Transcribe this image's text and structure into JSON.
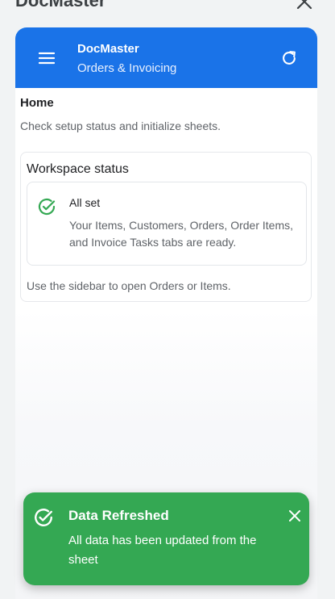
{
  "window": {
    "title": "DocMaster",
    "close_icon": "close-icon"
  },
  "header": {
    "title": "DocMaster",
    "subtitle": "Orders & Invoicing",
    "menu_icon": "menu-icon",
    "refresh_icon": "refresh-icon",
    "color": "#1a73e8"
  },
  "page": {
    "title": "Home",
    "description": "Check setup status and initialize sheets."
  },
  "workspace_card": {
    "title": "Workspace status",
    "status_title": "All set",
    "status_text": "Your Items, Customers, Orders, Order Items, and Invoice Tasks tabs are ready.",
    "status_icon": "check-circle-icon",
    "footer": "Use the sidebar to open Orders or Items."
  },
  "toast": {
    "title": "Data Refreshed",
    "message": "All data has been updated from the sheet",
    "icon": "check-circle-icon",
    "close_icon": "close-icon",
    "color": "#34a853"
  }
}
